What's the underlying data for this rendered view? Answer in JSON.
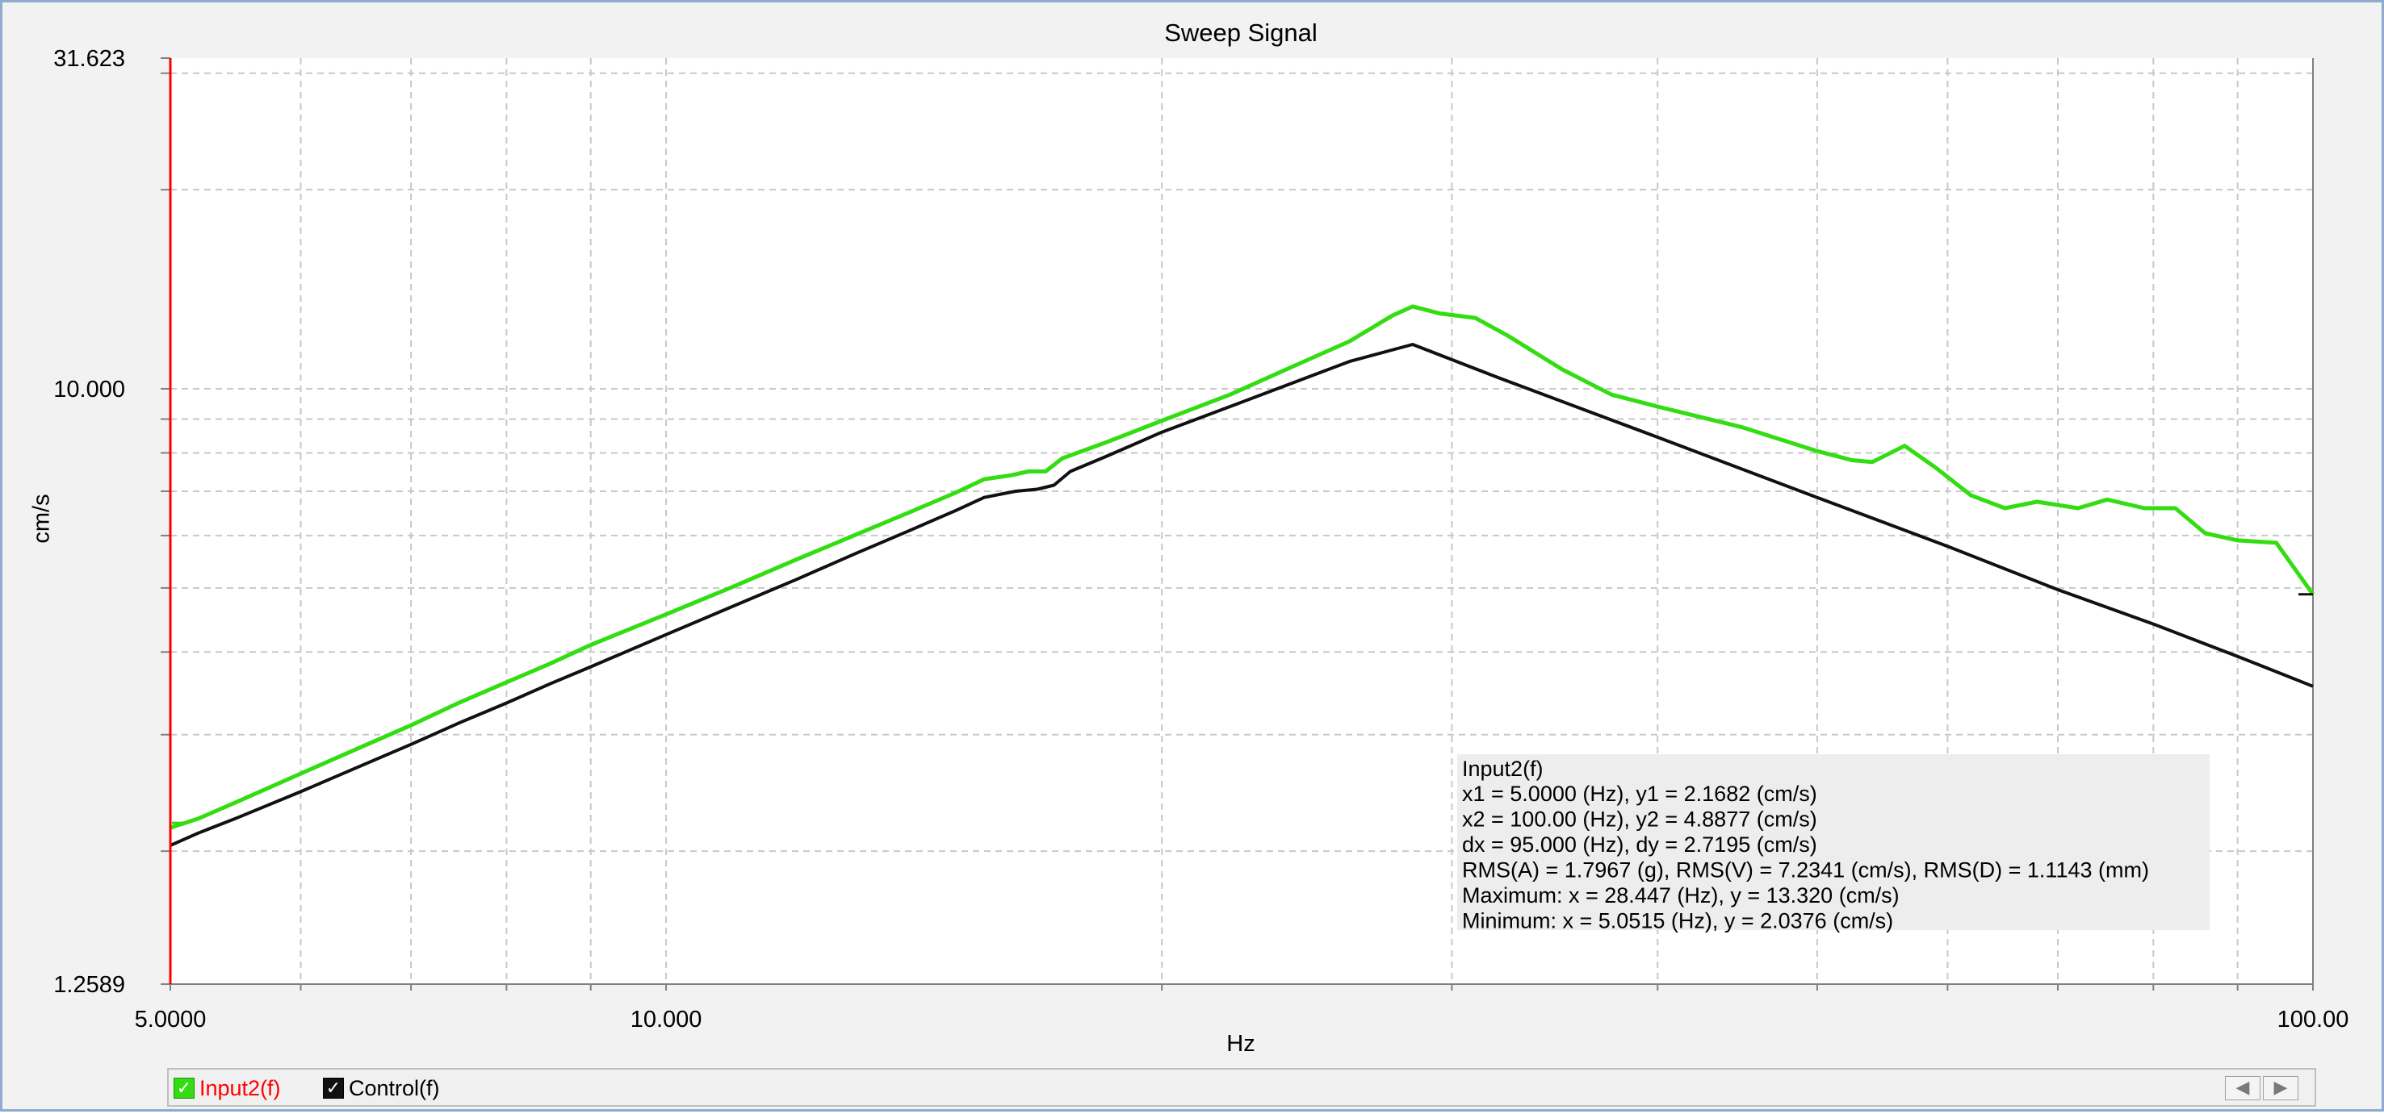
{
  "chart_data": {
    "type": "line",
    "title": "Sweep Signal",
    "xlabel": "Hz",
    "ylabel": "cm/s",
    "xscale": "log",
    "yscale": "log",
    "xlim": [
      5.0,
      100.0
    ],
    "ylim": [
      1.2589,
      31.623
    ],
    "x_tick_labels": [
      "5.0000",
      "10.000",
      "100.00"
    ],
    "y_tick_labels": [
      "31.623",
      "10.000",
      "1.2589"
    ],
    "grid": true,
    "series": [
      {
        "name": "Input2(f)",
        "color": "#33dd11",
        "points": [
          [
            5.0,
            2.17
          ],
          [
            5.2,
            2.24
          ],
          [
            5.5,
            2.38
          ],
          [
            6.0,
            2.62
          ],
          [
            6.5,
            2.86
          ],
          [
            7.0,
            3.1
          ],
          [
            7.5,
            3.36
          ],
          [
            8.0,
            3.6
          ],
          [
            8.5,
            3.84
          ],
          [
            9.0,
            4.1
          ],
          [
            10.0,
            4.56
          ],
          [
            11.0,
            5.03
          ],
          [
            12.0,
            5.52
          ],
          [
            13.0,
            6.0
          ],
          [
            14.0,
            6.48
          ],
          [
            15.0,
            6.97
          ],
          [
            15.6,
            7.3
          ],
          [
            16.2,
            7.4
          ],
          [
            16.6,
            7.5
          ],
          [
            17.0,
            7.5
          ],
          [
            17.4,
            7.85
          ],
          [
            18.5,
            8.3
          ],
          [
            20.0,
            8.95
          ],
          [
            22.0,
            9.8
          ],
          [
            24.0,
            10.8
          ],
          [
            26.0,
            11.8
          ],
          [
            27.6,
            12.9
          ],
          [
            28.4,
            13.32
          ],
          [
            29.5,
            13.0
          ],
          [
            31.0,
            12.8
          ],
          [
            32.5,
            12.0
          ],
          [
            35.0,
            10.7
          ],
          [
            37.5,
            9.8
          ],
          [
            40.0,
            9.4
          ],
          [
            45.0,
            8.75
          ],
          [
            50.0,
            8.05
          ],
          [
            52.5,
            7.8
          ],
          [
            54.0,
            7.75
          ],
          [
            56.5,
            8.2
          ],
          [
            59.0,
            7.6
          ],
          [
            62.0,
            6.9
          ],
          [
            65.0,
            6.6
          ],
          [
            68.0,
            6.75
          ],
          [
            72.0,
            6.6
          ],
          [
            75.0,
            6.8
          ],
          [
            79.0,
            6.6
          ],
          [
            82.5,
            6.6
          ],
          [
            86.0,
            6.05
          ],
          [
            90.0,
            5.9
          ],
          [
            95.0,
            5.85
          ],
          [
            100.0,
            4.89
          ]
        ]
      },
      {
        "name": "Control(f)",
        "color": "#111111",
        "points": [
          [
            5.0,
            2.04
          ],
          [
            5.2,
            2.13
          ],
          [
            5.5,
            2.25
          ],
          [
            6.0,
            2.46
          ],
          [
            6.5,
            2.68
          ],
          [
            7.0,
            2.9
          ],
          [
            7.5,
            3.13
          ],
          [
            8.0,
            3.35
          ],
          [
            8.5,
            3.58
          ],
          [
            9.0,
            3.8
          ],
          [
            10.0,
            4.25
          ],
          [
            11.0,
            4.7
          ],
          [
            12.0,
            5.15
          ],
          [
            13.0,
            5.62
          ],
          [
            14.0,
            6.08
          ],
          [
            15.0,
            6.55
          ],
          [
            15.6,
            6.85
          ],
          [
            16.3,
            7.0
          ],
          [
            16.8,
            7.05
          ],
          [
            17.2,
            7.15
          ],
          [
            17.6,
            7.5
          ],
          [
            18.5,
            7.9
          ],
          [
            20.0,
            8.6
          ],
          [
            22.0,
            9.4
          ],
          [
            24.0,
            10.2
          ],
          [
            26.0,
            11.0
          ],
          [
            28.4,
            11.67
          ],
          [
            32.0,
            10.4
          ],
          [
            40.0,
            8.45
          ],
          [
            50.0,
            6.85
          ],
          [
            60.0,
            5.78
          ],
          [
            70.0,
            4.97
          ],
          [
            80.0,
            4.41
          ],
          [
            90.0,
            3.94
          ],
          [
            100.0,
            3.55
          ]
        ]
      }
    ],
    "annotation": {
      "title": "Input2(f)",
      "lines": [
        "x1 = 5.0000 (Hz), y1 = 2.1682 (cm/s)",
        "x2 = 100.00 (Hz), y2 = 4.8877 (cm/s)",
        "dx = 95.000 (Hz), dy = 2.7195 (cm/s)",
        "RMS(A) = 1.7967 (g), RMS(V) = 7.2341 (cm/s), RMS(D) = 1.1143 (mm)",
        "Maximum: x = 28.447 (Hz), y = 13.320 (cm/s)",
        "Minimum: x = 5.0515 (Hz), y = 2.0376 (cm/s)"
      ]
    },
    "cursor_x": 5.0
  },
  "legend": {
    "items": [
      {
        "label": "Input2(f)",
        "color": "#ff0000",
        "box_color": "#33dd11"
      },
      {
        "label": "Control(f)",
        "color": "#000000",
        "box_color": "#111111"
      }
    ]
  },
  "scrollbar": {
    "left_icon": "arrow-left-icon",
    "right_icon": "arrow-right-icon"
  }
}
